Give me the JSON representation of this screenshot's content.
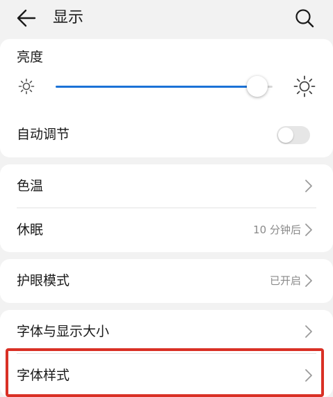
{
  "header": {
    "title": "显示",
    "back_icon": "arrow-left-icon",
    "search_icon": "search-icon"
  },
  "brightness": {
    "label": "亮度",
    "level": 0.93,
    "fill_color": "#1b72d6",
    "low_icon": "sun-small-icon",
    "high_icon": "sun-large-icon"
  },
  "auto_adjust": {
    "label": "自动调节",
    "enabled": false
  },
  "color_temp": {
    "label": "色温"
  },
  "sleep": {
    "label": "休眠",
    "value": "10 分钟后"
  },
  "eye_comfort": {
    "label": "护眼模式",
    "value": "已开启"
  },
  "font_display_size": {
    "label": "字体与显示大小"
  },
  "font_style": {
    "label": "字体样式"
  },
  "highlight_color": "#d93025"
}
